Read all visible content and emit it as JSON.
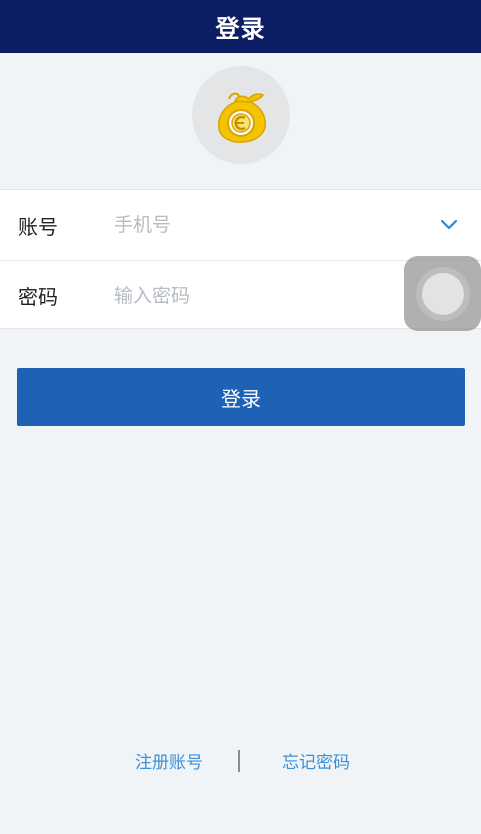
{
  "header": {
    "title": "登录"
  },
  "logo": {
    "icon": "money-bag-icon",
    "color": "#f2c200"
  },
  "form": {
    "account": {
      "label": "账号",
      "placeholder": "手机号",
      "value": ""
    },
    "password": {
      "label": "密码",
      "placeholder": "输入密码",
      "value": ""
    },
    "dropdown_icon": "chevron-down-icon"
  },
  "login_button": {
    "label": "登录"
  },
  "footer": {
    "register_label": "注册账号",
    "forgot_label": "忘记密码"
  },
  "colors": {
    "header_bg": "#0c1d63",
    "button_bg": "#1e62b6",
    "link": "#3b8fd6",
    "page_bg": "#f1f4f7"
  }
}
